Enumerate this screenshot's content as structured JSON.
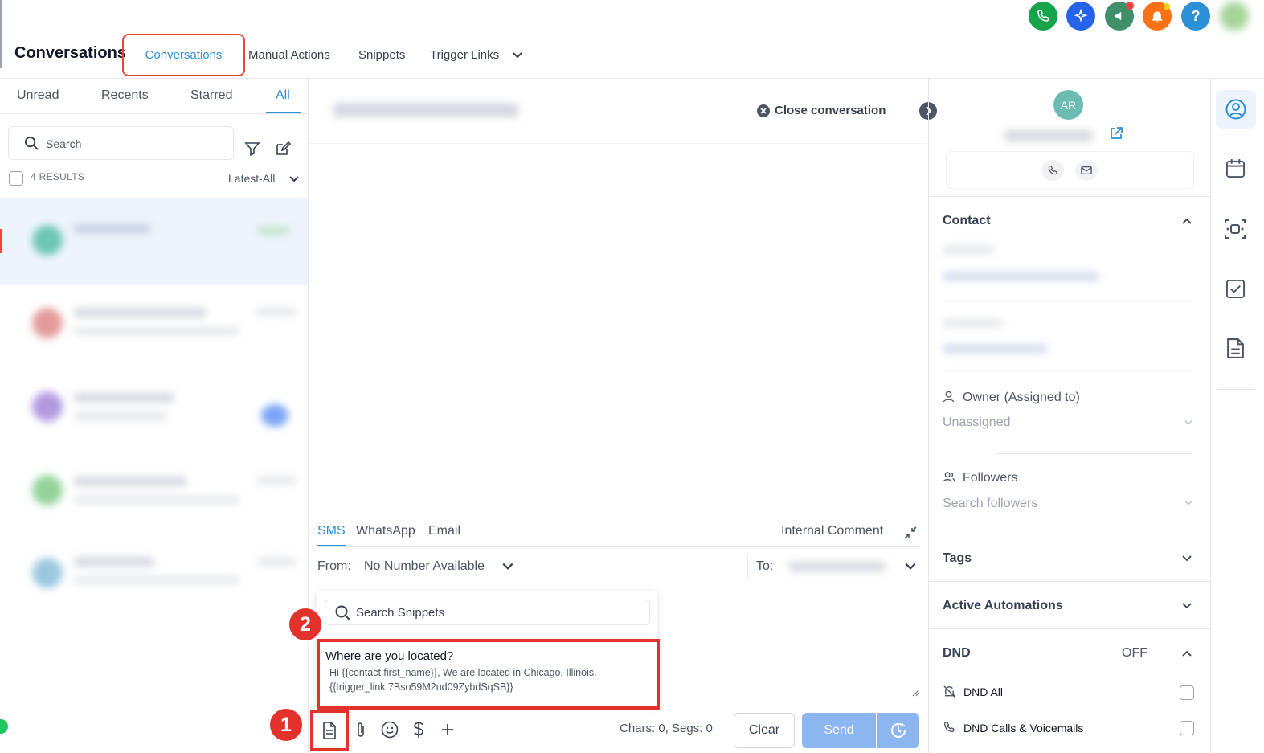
{
  "topbar": {
    "app_title": "Conversations",
    "nav": [
      "Conversations",
      "Manual Actions",
      "Snippets",
      "Trigger Links"
    ]
  },
  "left": {
    "tabs": [
      "Unread",
      "Recents",
      "Starred",
      "All"
    ],
    "active_tab": "All",
    "search_placeholder": "Search",
    "results": "4 RESULTS",
    "sort": "Latest-All"
  },
  "middle": {
    "close_conversation": "Close conversation",
    "channels": [
      "SMS",
      "WhatsApp",
      "Email"
    ],
    "internal_comment": "Internal Comment",
    "from_label": "From:",
    "from_value": "No Number Available",
    "to_label": "To:",
    "snippet_search_placeholder": "Search Snippets",
    "snippet_title": "Where are you located?",
    "snippet_body_1": "Hi {{contact.first_name}}, We are located in Chicago, Illinois.",
    "snippet_body_2": "{{trigger_link.7Bso59M2ud09ZybdSqSB}}",
    "chars": "Chars: 0, Segs: 0",
    "clear": "Clear",
    "send": "Send",
    "marker_1": "1",
    "marker_2": "2"
  },
  "right": {
    "avatar_initials": "AR",
    "contact": "Contact",
    "owner_label": "Owner (Assigned to)",
    "owner_value": "Unassigned",
    "followers_label": "Followers",
    "followers_placeholder": "Search followers",
    "tags": "Tags",
    "active_automations": "Active Automations",
    "dnd": "DND",
    "dnd_status": "OFF",
    "dnd_all": "DND All",
    "dnd_calls": "DND Calls & Voicemails"
  },
  "colors": {
    "accent": "#2d8fd5",
    "highlight": "#e3322b",
    "send_button": "#8cb6ef"
  }
}
